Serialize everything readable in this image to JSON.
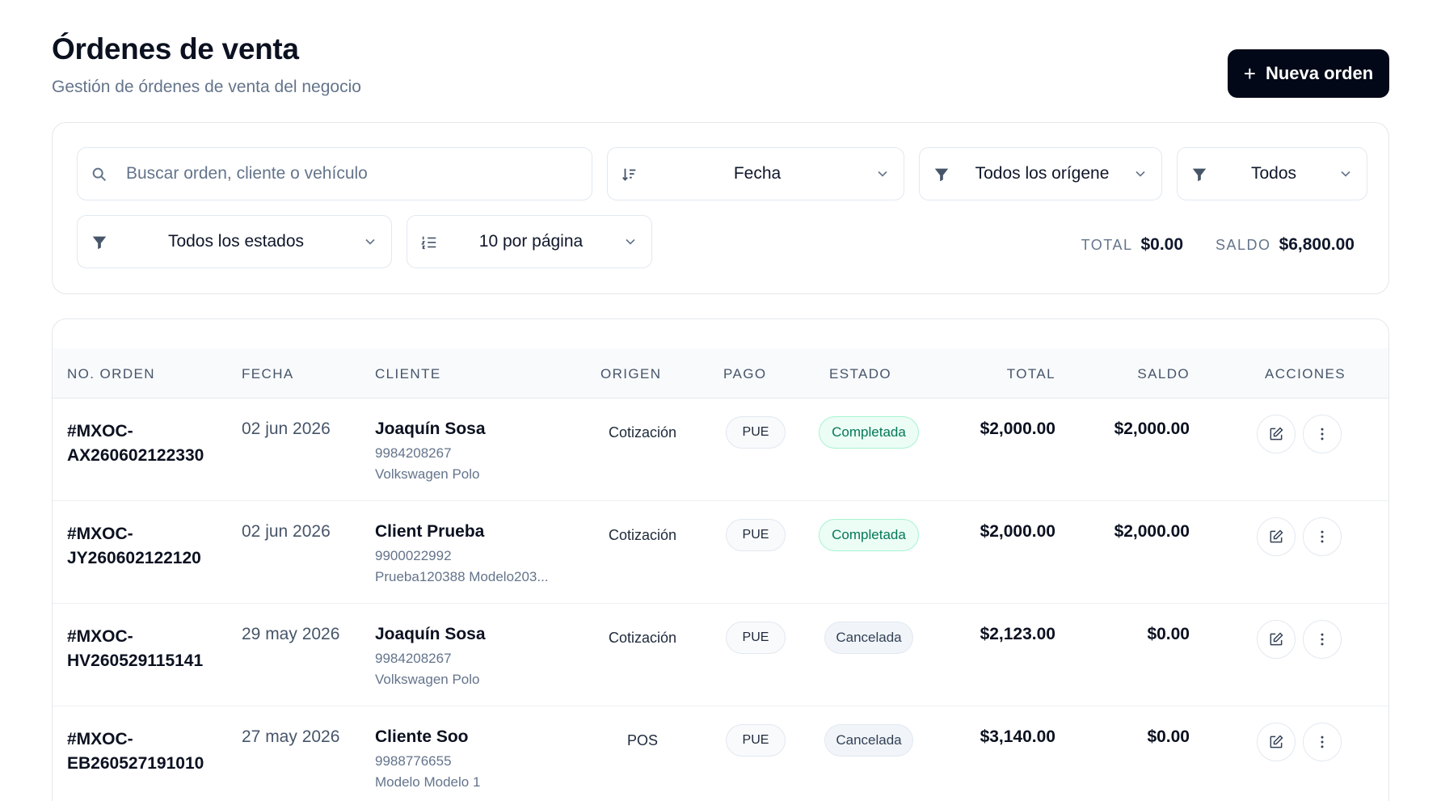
{
  "header": {
    "title": "Órdenes de venta",
    "subtitle": "Gestión de órdenes de venta del negocio",
    "new_order_label": "Nueva orden",
    "new_order_icon": "plus-icon"
  },
  "filters": {
    "search_placeholder": "Buscar orden, cliente o vehículo",
    "sort_value": "Fecha",
    "origin_value": "Todos los orígene",
    "type_value": "Todos",
    "status_value": "Todos los estados",
    "page_size_value": "10 por página"
  },
  "summary": {
    "total_label": "TOTAL",
    "total_value": "$0.00",
    "saldo_label": "SALDO",
    "saldo_value": "$6,800.00"
  },
  "table": {
    "columns": [
      "NO. ORDEN",
      "FECHA",
      "CLIENTE",
      "ORIGEN",
      "PAGO",
      "ESTADO",
      "TOTAL",
      "SALDO",
      "ACCIONES"
    ],
    "rows": [
      {
        "order_line1": "#MXOC-",
        "order_line2": "AX260602122330",
        "date": "02 jun 2026",
        "client": "Joaquín Sosa",
        "phone": "9984208267",
        "vehicle": "Volkswagen Polo",
        "origin": "Cotización",
        "pago": "PUE",
        "estado": "Completada",
        "total": "$2,000.00",
        "saldo": "$2,000.00"
      },
      {
        "order_line1": "#MXOC-",
        "order_line2": "JY260602122120",
        "date": "02 jun 2026",
        "client": "Client Prueba",
        "phone": "9900022992",
        "vehicle": "Prueba120388 Modelo203...",
        "origin": "Cotización",
        "pago": "PUE",
        "estado": "Completada",
        "total": "$2,000.00",
        "saldo": "$2,000.00"
      },
      {
        "order_line1": "#MXOC-",
        "order_line2": "HV260529115141",
        "date": "29 may 2026",
        "client": "Joaquín Sosa",
        "phone": "9984208267",
        "vehicle": "Volkswagen Polo",
        "origin": "Cotización",
        "pago": "PUE",
        "estado": "Cancelada",
        "total": "$2,123.00",
        "saldo": "$0.00"
      },
      {
        "order_line1": "#MXOC-",
        "order_line2": "EB260527191010",
        "date": "27 may 2026",
        "client": "Cliente Soo",
        "phone": "9988776655",
        "vehicle": "Modelo Modelo 1",
        "origin": "POS",
        "pago": "PUE",
        "estado": "Cancelada",
        "total": "$3,140.00",
        "saldo": "$0.00"
      }
    ]
  },
  "colors": {
    "primary_button": "#020817",
    "completed_bg": "#ecfdf5",
    "completed_text": "#047857",
    "cancelled_bg": "#f1f5f9"
  }
}
